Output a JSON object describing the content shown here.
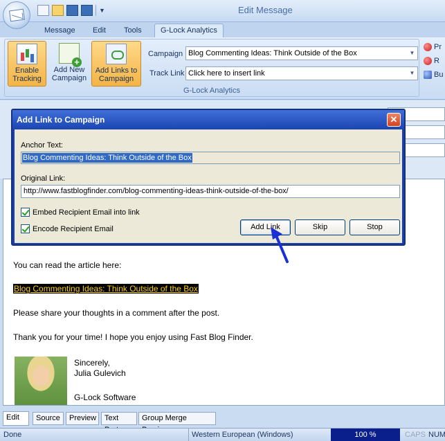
{
  "window": {
    "title": "Edit Message"
  },
  "ribbon_tabs": [
    {
      "label": "Message"
    },
    {
      "label": "Edit"
    },
    {
      "label": "Tools"
    },
    {
      "label": "G-Lock Analytics",
      "active": true
    }
  ],
  "ribbon": {
    "buttons": {
      "enable_tracking": "Enable Tracking",
      "add_new_campaign": "Add New Campaign",
      "add_links": "Add Links to Campaign"
    },
    "campaign_label": "Campaign",
    "campaign_value": "Blog Commenting Ideas: Think Outside of the Box",
    "track_link_label": "Track Link",
    "track_link_value": "Click here to insert link",
    "group_label": "G-Lock Analytics",
    "side_items": [
      "Pr",
      "R",
      "Bu"
    ]
  },
  "dialog": {
    "title": "Add Link to Campaign",
    "anchor_label": "Anchor Text:",
    "anchor_value": "Blog Commenting Ideas: Think Outside of the Box",
    "original_label": "Original Link:",
    "original_value": "http://www.fastblogfinder.com/blog-commenting-ideas-think-outside-of-the-box/",
    "embed_label": "Embed Recipient Email into link",
    "encode_label": "Encode Recipient Email",
    "embed_checked": true,
    "encode_checked": true,
    "buttons": {
      "add_link": "Add Link",
      "skip": "Skip",
      "stop": "Stop"
    }
  },
  "editor": {
    "line1": "You can read the article here:",
    "link_text": "Blog Commenting Ideas: Think Outside of the Box",
    "line2": "Please share your thoughts in a comment after the post.",
    "line3": "Thank you for your time! I hope you enjoy using Fast Blog Finder.",
    "sig1": "Sincerely,",
    "sig2": "Julia Gulevich",
    "sig3": "G-Lock Software"
  },
  "bottom_tabs": [
    {
      "label": "Edit",
      "active": true
    },
    {
      "label": "Source"
    },
    {
      "label": "Preview"
    },
    {
      "label": "Text Part"
    },
    {
      "label": "Group Merge Preview"
    }
  ],
  "status": {
    "left": "Done",
    "encoding": "Western European (Windows)",
    "zoom": "100 %",
    "caps": "CAPS",
    "num": "NUM"
  },
  "colors": {
    "dialog_title": "#1b45b2",
    "selection": "#316ac5",
    "link_highlight_bg": "#000000",
    "link_highlight_fg": "#ffd200",
    "pointer_arrow": "#1a2fd6",
    "zoom_cell": "#0b1f8c"
  }
}
